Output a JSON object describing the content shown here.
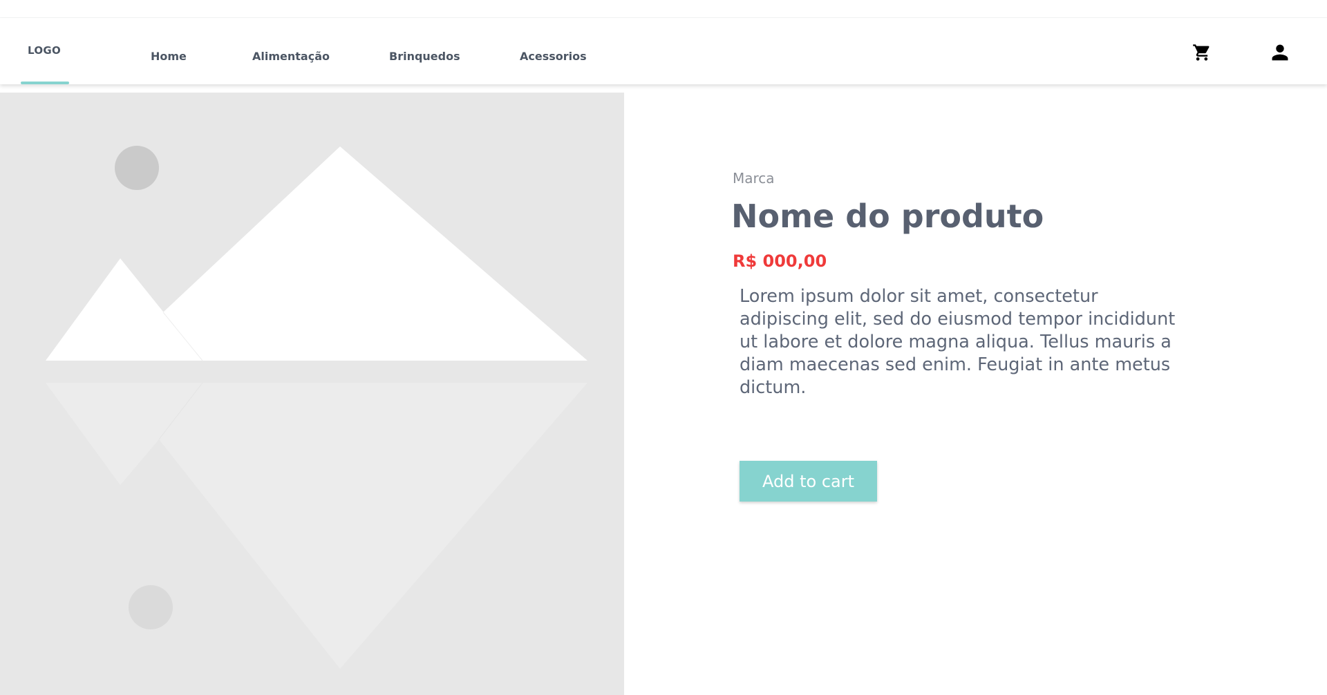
{
  "header": {
    "logo": "LOGO",
    "nav": [
      {
        "label": "Home"
      },
      {
        "label": "Alimentação"
      },
      {
        "label": "Brinquedos"
      },
      {
        "label": "Acessorios"
      }
    ],
    "cart_icon": "cart-icon",
    "user_icon": "user-icon"
  },
  "product": {
    "brand": "Marca",
    "name": "Nome do produto",
    "price": "R$ 000,00",
    "description": "Lorem ipsum dolor sit amet, consectetur adipiscing elit, sed do eiusmod tempor incididunt ut labore et dolore magna aliqua. Tellus mauris a diam maecenas sed enim. Feugiat in ante metus dictum.",
    "add_to_cart_label": "Add to cart",
    "image_icon": "image-placeholder-icon"
  },
  "colors": {
    "accent": "#86d3cf",
    "price": "#ef3a3a",
    "text": "#586070",
    "placeholder_bg": "#e7e7e7"
  }
}
